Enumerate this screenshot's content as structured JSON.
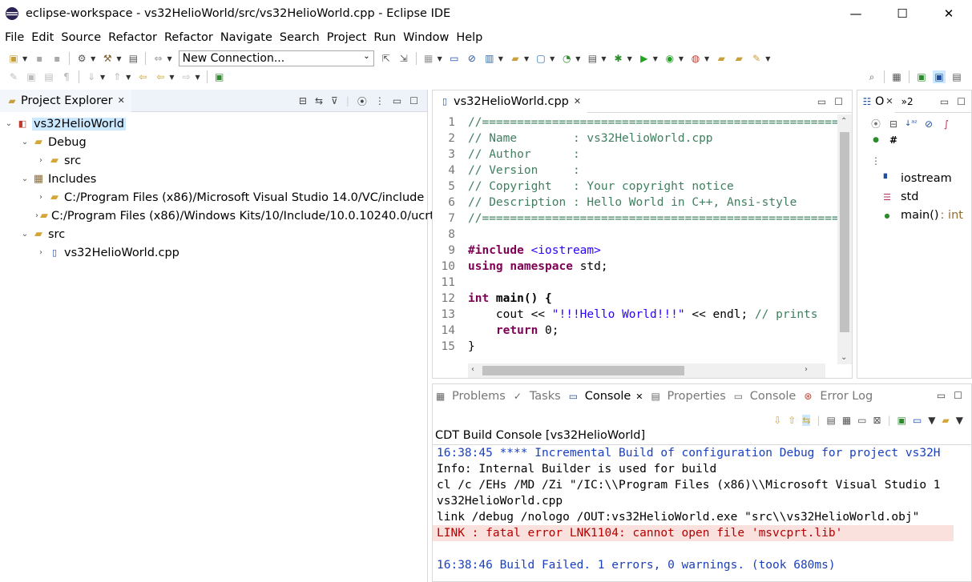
{
  "window": {
    "title": "eclipse-workspace - vs32HelioWorld/src/vs32HelioWorld.cpp - Eclipse IDE",
    "minimize": "—",
    "maximize": "☐",
    "close": "✕"
  },
  "menu": [
    "File",
    "Edit",
    "Source",
    "Refactor",
    "Refactor",
    "Navigate",
    "Search",
    "Project",
    "Run",
    "Window",
    "Help"
  ],
  "toolbar": {
    "connection_combo": "New Connection..."
  },
  "project_explorer": {
    "tab_label": "Project Explorer",
    "tree": [
      {
        "label": "vs32HelioWorld",
        "icon": "cpp-project-icon"
      },
      {
        "label": "Debug",
        "icon": "folder-icon"
      },
      {
        "label": "src",
        "icon": "folder-icon"
      },
      {
        "label": "Includes",
        "icon": "includes-icon"
      },
      {
        "label": "C:/Program Files (x86)/Microsoft Visual Studio 14.0/VC/include",
        "icon": "include-folder-icon"
      },
      {
        "label": "C:/Program Files (x86)/Windows Kits/10/Include/10.0.10240.0/ucrt",
        "icon": "include-folder-icon"
      },
      {
        "label": "src",
        "icon": "source-folder-icon"
      },
      {
        "label": "vs32HelioWorld.cpp",
        "icon": "cpp-file-icon"
      }
    ]
  },
  "editor": {
    "tab_label": "vs32HelioWorld.cpp",
    "lines": [
      {
        "n": "1",
        "text": "//===================================================="
      },
      {
        "n": "2",
        "text": "// Name        : vs32HelioWorld.cpp"
      },
      {
        "n": "3",
        "text": "// Author      :"
      },
      {
        "n": "4",
        "text": "// Version     :"
      },
      {
        "n": "5",
        "text": "// Copyright   : Your copyright notice"
      },
      {
        "n": "6",
        "text": "// Description : Hello World in C++, Ansi-style"
      },
      {
        "n": "7",
        "text": "//===================================================="
      },
      {
        "n": "8",
        "text": ""
      },
      {
        "n": "9",
        "kw": "#include ",
        "str": "<iostream>"
      },
      {
        "n": "10",
        "kw": "using namespace ",
        "rest": "std;"
      },
      {
        "n": "11",
        "text": ""
      },
      {
        "n": "12",
        "kw": "int ",
        "rest": "main() {"
      },
      {
        "n": "13",
        "pre": "    cout << ",
        "str": "\"!!!Hello World!!!\"",
        "rest": " << endl; ",
        "comment": "// prints"
      },
      {
        "n": "14",
        "pre": "    ",
        "kw": "return ",
        "rest": "0;"
      },
      {
        "n": "15",
        "text": "}"
      }
    ]
  },
  "outline": {
    "tab_label": "O",
    "overflow_label": "»2",
    "items": [
      {
        "label": "iostream",
        "icon": "include-icon"
      },
      {
        "label": "std",
        "icon": "namespace-icon"
      },
      {
        "label": "main()",
        "type": " : int",
        "icon": "function-icon"
      }
    ]
  },
  "console": {
    "tabs": [
      "Problems",
      "Tasks",
      "Console",
      "Properties",
      "Console",
      "Error Log"
    ],
    "title": "CDT Build Console [vs32HelioWorld]",
    "lines": [
      "16:38:45 **** Incremental Build of configuration Debug for project vs32H",
      "Info: Internal Builder is used for build",
      "cl /c /EHs /MD /Zi \"/IC:\\\\Program Files (x86)\\\\Microsoft Visual Studio 1",
      "vs32HelioWorld.cpp",
      "link /debug /nologo /OUT:vs32HelioWorld.exe \"src\\\\vs32HelioWorld.obj\"",
      "LINK : fatal error LNK1104: cannot open file 'msvcprt.lib'",
      "",
      "16:38:46 Build Failed. 1 errors, 0 warnings. (took 680ms)"
    ]
  }
}
